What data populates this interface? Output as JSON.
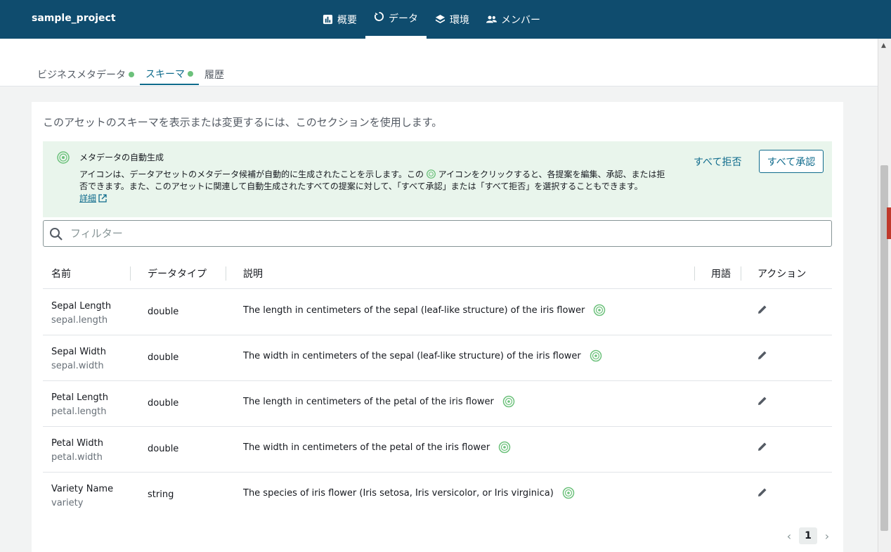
{
  "header": {
    "project_name": "sample_project",
    "nav": [
      {
        "label": "概要",
        "icon": "bar-chart-icon",
        "active": false
      },
      {
        "label": "データ",
        "icon": "refresh-icon",
        "active": true
      },
      {
        "label": "環境",
        "icon": "layers-icon",
        "active": false
      },
      {
        "label": "メンバー",
        "icon": "people-icon",
        "active": false
      }
    ]
  },
  "tabs": [
    {
      "label": "ビジネスメタデータ",
      "status_dot": true
    },
    {
      "label": "スキーマ",
      "status_dot": true,
      "active": true
    },
    {
      "label": "履歴",
      "status_dot": false
    }
  ],
  "intro_text": "このアセットのスキーマを表示または変更するには、このセクションを使用します。",
  "alert": {
    "title": "メタデータの自動生成",
    "body_part1": "アイコンは、データアセットのメタデータ候補が自動的に生成されたことを示します。この",
    "body_part2": "アイコンをクリックすると、各提案を編集、承認、または拒否できます。また、このアセットに関連して自動生成されたすべての提案に対して、「すべて承認」または「すべて拒否」を選択することもできます。",
    "link": "詳細",
    "reject_all": "すべて拒否",
    "approve_all": "すべて承認"
  },
  "filter": {
    "placeholder": "フィルター"
  },
  "table": {
    "headers": {
      "name": "名前",
      "type": "データタイプ",
      "desc": "説明",
      "term": "用語",
      "action": "アクション"
    },
    "rows": [
      {
        "name": "Sepal Length",
        "column": "sepal.length",
        "type": "double",
        "desc": "The length in centimeters of the sepal (leaf-like structure) of the iris flower"
      },
      {
        "name": "Sepal Width",
        "column": "sepal.width",
        "type": "double",
        "desc": "The width in centimeters of the sepal (leaf-like structure) of the iris flower"
      },
      {
        "name": "Petal Length",
        "column": "petal.length",
        "type": "double",
        "desc": "The length in centimeters of the petal of the iris flower"
      },
      {
        "name": "Petal Width",
        "column": "petal.width",
        "type": "double",
        "desc": "The width in centimeters of the petal of the iris flower"
      },
      {
        "name": "Variety Name",
        "column": "variety",
        "type": "string",
        "desc": "The species of iris flower (Iris setosa, Iris versicolor, or Iris virginica)"
      }
    ]
  },
  "pagination": {
    "current_page": "1"
  },
  "colors": {
    "header_bg": "#0f4c6e",
    "accent": "#0f6b8c",
    "ai_green": "#6cc17b",
    "alert_bg": "#e9f5ec"
  }
}
